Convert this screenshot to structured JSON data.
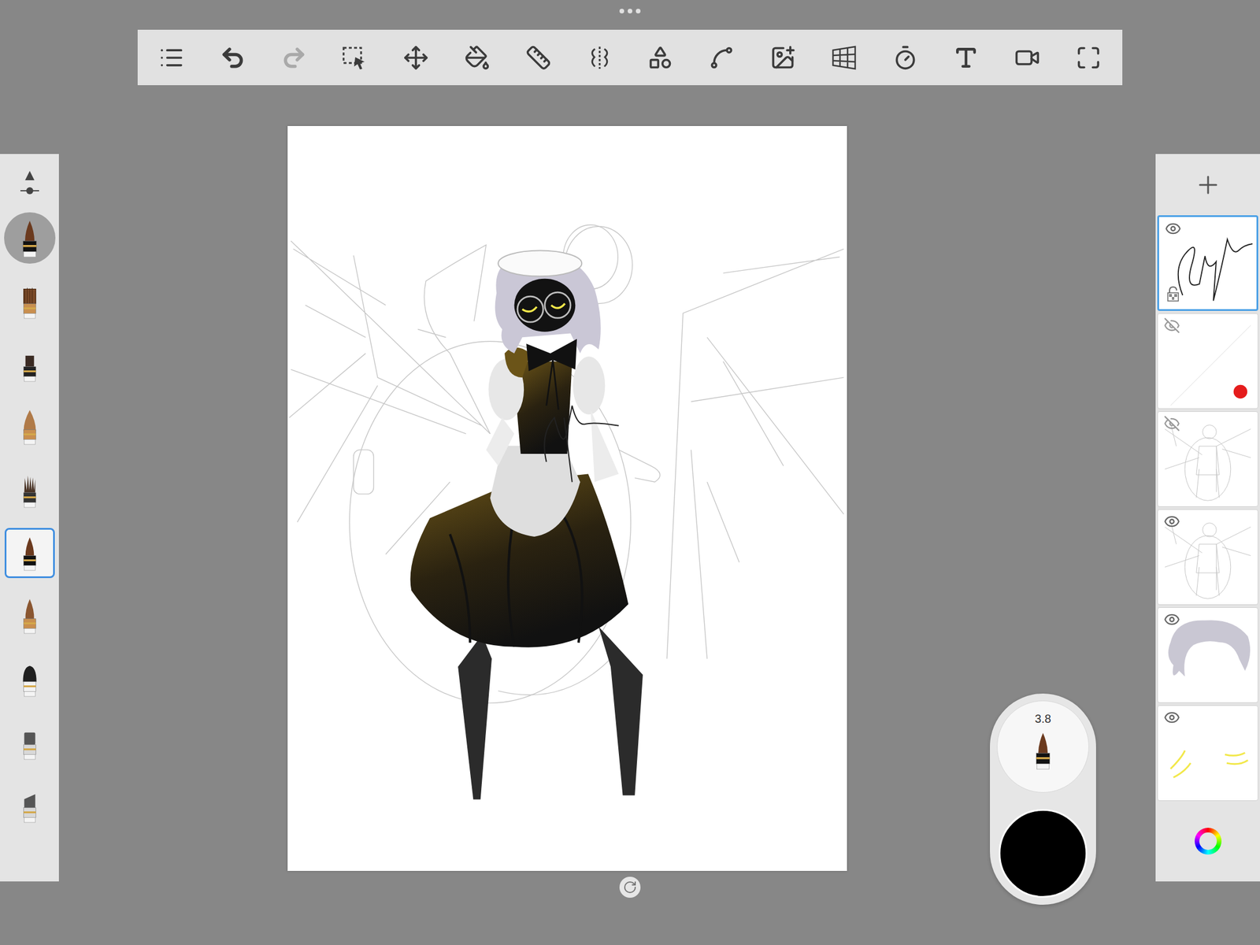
{
  "toolbar": {
    "tools": [
      {
        "kind": "menu",
        "disabled": false
      },
      {
        "kind": "undo",
        "disabled": false
      },
      {
        "kind": "redo",
        "disabled": true
      },
      {
        "kind": "select",
        "disabled": false
      },
      {
        "kind": "move",
        "disabled": false
      },
      {
        "kind": "fill",
        "disabled": false
      },
      {
        "kind": "ruler",
        "disabled": false
      },
      {
        "kind": "symmetry",
        "disabled": false
      },
      {
        "kind": "shapes",
        "disabled": false
      },
      {
        "kind": "stroke",
        "disabled": false
      },
      {
        "kind": "add-image",
        "disabled": false
      },
      {
        "kind": "perspective",
        "disabled": false
      },
      {
        "kind": "time-lapse",
        "disabled": false
      },
      {
        "kind": "text",
        "disabled": false
      },
      {
        "kind": "record",
        "disabled": false
      },
      {
        "kind": "fullscreen",
        "disabled": false
      }
    ]
  },
  "brush_panel": {
    "current_brush": {
      "kind": "ink"
    },
    "brushes": [
      {
        "kind": "flat",
        "selected": false
      },
      {
        "kind": "small-flat",
        "selected": false
      },
      {
        "kind": "round",
        "selected": false
      },
      {
        "kind": "bristle",
        "selected": false
      },
      {
        "kind": "ink",
        "selected": true
      },
      {
        "kind": "pointed",
        "selected": false
      },
      {
        "kind": "powder",
        "selected": false
      },
      {
        "kind": "marker",
        "selected": false
      },
      {
        "kind": "chisel",
        "selected": false
      }
    ]
  },
  "layers": [
    {
      "kind": "signature",
      "visible": true,
      "selected": true
    },
    {
      "kind": "stroke-dot",
      "visible": false,
      "selected": false
    },
    {
      "kind": "sketch",
      "visible": false,
      "selected": false
    },
    {
      "kind": "sketch",
      "visible": true,
      "selected": false
    },
    {
      "kind": "hair",
      "visible": true,
      "selected": false
    },
    {
      "kind": "eyes",
      "visible": true,
      "selected": false
    }
  ],
  "brush_puck": {
    "size": "3.8",
    "color": "#000000"
  }
}
